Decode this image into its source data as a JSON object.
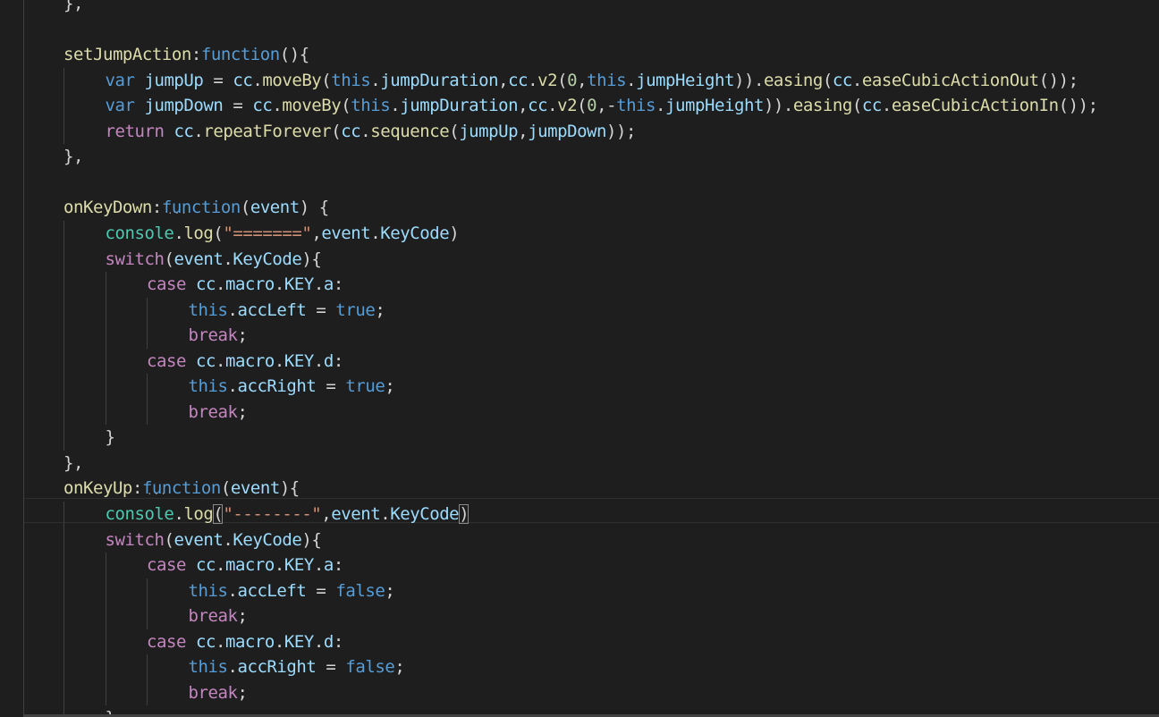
{
  "editor": {
    "language": "javascript",
    "theme": "dark",
    "colors": {
      "background": "#1e1e1e",
      "keyword": "#569cd6",
      "control": "#c586c0",
      "function": "#dcdcaa",
      "variable": "#9cdcfe",
      "object": "#4ec9b0",
      "string": "#ce9178",
      "number": "#b5cea8",
      "text": "#d4d4d4"
    },
    "lines": [
      {
        "indent": 0,
        "tokens": [
          {
            "t": "},",
            "c": "pun"
          }
        ]
      },
      {
        "indent": 0,
        "tokens": []
      },
      {
        "indent": 0,
        "tokens": [
          {
            "t": "setJumpAction",
            "c": "fn"
          },
          {
            "t": ":",
            "c": "pun"
          },
          {
            "t": "function",
            "c": "kw"
          },
          {
            "t": "(){",
            "c": "pun"
          }
        ]
      },
      {
        "indent": 1,
        "tokens": [
          {
            "t": "var",
            "c": "kw"
          },
          {
            "t": " ",
            "c": "pun"
          },
          {
            "t": "jumpUp",
            "c": "var"
          },
          {
            "t": " = ",
            "c": "pun"
          },
          {
            "t": "cc",
            "c": "var"
          },
          {
            "t": ".",
            "c": "pun"
          },
          {
            "t": "moveBy",
            "c": "fn"
          },
          {
            "t": "(",
            "c": "pun"
          },
          {
            "t": "this",
            "c": "kw"
          },
          {
            "t": ".",
            "c": "pun"
          },
          {
            "t": "jumpDuration",
            "c": "var"
          },
          {
            "t": ",",
            "c": "pun"
          },
          {
            "t": "cc",
            "c": "var"
          },
          {
            "t": ".",
            "c": "pun"
          },
          {
            "t": "v2",
            "c": "fn"
          },
          {
            "t": "(",
            "c": "pun"
          },
          {
            "t": "0",
            "c": "num"
          },
          {
            "t": ",",
            "c": "pun"
          },
          {
            "t": "this",
            "c": "kw"
          },
          {
            "t": ".",
            "c": "pun"
          },
          {
            "t": "jumpHeight",
            "c": "var"
          },
          {
            "t": ")).",
            "c": "pun"
          },
          {
            "t": "easing",
            "c": "fn"
          },
          {
            "t": "(",
            "c": "pun"
          },
          {
            "t": "cc",
            "c": "var"
          },
          {
            "t": ".",
            "c": "pun"
          },
          {
            "t": "easeCubicActionOut",
            "c": "fn"
          },
          {
            "t": "());",
            "c": "pun"
          }
        ]
      },
      {
        "indent": 1,
        "tokens": [
          {
            "t": "var",
            "c": "kw"
          },
          {
            "t": " ",
            "c": "pun"
          },
          {
            "t": "jumpDown",
            "c": "var"
          },
          {
            "t": " = ",
            "c": "pun"
          },
          {
            "t": "cc",
            "c": "var"
          },
          {
            "t": ".",
            "c": "pun"
          },
          {
            "t": "moveBy",
            "c": "fn"
          },
          {
            "t": "(",
            "c": "pun"
          },
          {
            "t": "this",
            "c": "kw"
          },
          {
            "t": ".",
            "c": "pun"
          },
          {
            "t": "jumpDuration",
            "c": "var"
          },
          {
            "t": ",",
            "c": "pun"
          },
          {
            "t": "cc",
            "c": "var"
          },
          {
            "t": ".",
            "c": "pun"
          },
          {
            "t": "v2",
            "c": "fn"
          },
          {
            "t": "(",
            "c": "pun"
          },
          {
            "t": "0",
            "c": "num"
          },
          {
            "t": ",-",
            "c": "pun"
          },
          {
            "t": "this",
            "c": "kw"
          },
          {
            "t": ".",
            "c": "pun"
          },
          {
            "t": "jumpHeight",
            "c": "var"
          },
          {
            "t": ")).",
            "c": "pun"
          },
          {
            "t": "easing",
            "c": "fn"
          },
          {
            "t": "(",
            "c": "pun"
          },
          {
            "t": "cc",
            "c": "var"
          },
          {
            "t": ".",
            "c": "pun"
          },
          {
            "t": "easeCubicActionIn",
            "c": "fn"
          },
          {
            "t": "());",
            "c": "pun"
          }
        ]
      },
      {
        "indent": 1,
        "tokens": [
          {
            "t": "return",
            "c": "ctl"
          },
          {
            "t": " ",
            "c": "pun"
          },
          {
            "t": "cc",
            "c": "var"
          },
          {
            "t": ".",
            "c": "pun"
          },
          {
            "t": "repeatForever",
            "c": "fn"
          },
          {
            "t": "(",
            "c": "pun"
          },
          {
            "t": "cc",
            "c": "var"
          },
          {
            "t": ".",
            "c": "pun"
          },
          {
            "t": "sequence",
            "c": "fn"
          },
          {
            "t": "(",
            "c": "pun"
          },
          {
            "t": "jumpUp",
            "c": "var"
          },
          {
            "t": ",",
            "c": "pun"
          },
          {
            "t": "jumpDown",
            "c": "var"
          },
          {
            "t": "));",
            "c": "pun"
          }
        ]
      },
      {
        "indent": 0,
        "tokens": [
          {
            "t": "},",
            "c": "pun"
          }
        ]
      },
      {
        "indent": 0,
        "tokens": []
      },
      {
        "indent": 0,
        "tokens": [
          {
            "t": "onKeyDown",
            "c": "fn"
          },
          {
            "t": ":",
            "c": "pun"
          },
          {
            "t": "function",
            "c": "kw"
          },
          {
            "t": "(",
            "c": "pun"
          },
          {
            "t": "event",
            "c": "var"
          },
          {
            "t": ") {",
            "c": "pun"
          }
        ]
      },
      {
        "indent": 1,
        "tokens": [
          {
            "t": "console",
            "c": "obj"
          },
          {
            "t": ".",
            "c": "pun"
          },
          {
            "t": "log",
            "c": "fn"
          },
          {
            "t": "(",
            "c": "pun"
          },
          {
            "t": "\"=======\"",
            "c": "str"
          },
          {
            "t": ",",
            "c": "pun"
          },
          {
            "t": "event",
            "c": "var"
          },
          {
            "t": ".",
            "c": "pun"
          },
          {
            "t": "KeyCode",
            "c": "var"
          },
          {
            "t": ")",
            "c": "pun"
          }
        ]
      },
      {
        "indent": 1,
        "tokens": [
          {
            "t": "switch",
            "c": "ctl"
          },
          {
            "t": "(",
            "c": "pun"
          },
          {
            "t": "event",
            "c": "var"
          },
          {
            "t": ".",
            "c": "pun"
          },
          {
            "t": "KeyCode",
            "c": "var"
          },
          {
            "t": "){",
            "c": "pun"
          }
        ]
      },
      {
        "indent": 2,
        "tokens": [
          {
            "t": "case",
            "c": "ctl"
          },
          {
            "t": " ",
            "c": "pun"
          },
          {
            "t": "cc",
            "c": "var"
          },
          {
            "t": ".",
            "c": "pun"
          },
          {
            "t": "macro",
            "c": "var"
          },
          {
            "t": ".",
            "c": "pun"
          },
          {
            "t": "KEY",
            "c": "var"
          },
          {
            "t": ".",
            "c": "pun"
          },
          {
            "t": "a",
            "c": "var"
          },
          {
            "t": ":",
            "c": "pun"
          }
        ]
      },
      {
        "indent": 3,
        "tokens": [
          {
            "t": "this",
            "c": "kw"
          },
          {
            "t": ".",
            "c": "pun"
          },
          {
            "t": "accLeft",
            "c": "var"
          },
          {
            "t": " = ",
            "c": "pun"
          },
          {
            "t": "true",
            "c": "kw"
          },
          {
            "t": ";",
            "c": "pun"
          }
        ]
      },
      {
        "indent": 3,
        "tokens": [
          {
            "t": "break",
            "c": "ctl"
          },
          {
            "t": ";",
            "c": "pun"
          }
        ]
      },
      {
        "indent": 2,
        "tokens": [
          {
            "t": "case",
            "c": "ctl"
          },
          {
            "t": " ",
            "c": "pun"
          },
          {
            "t": "cc",
            "c": "var"
          },
          {
            "t": ".",
            "c": "pun"
          },
          {
            "t": "macro",
            "c": "var"
          },
          {
            "t": ".",
            "c": "pun"
          },
          {
            "t": "KEY",
            "c": "var"
          },
          {
            "t": ".",
            "c": "pun"
          },
          {
            "t": "d",
            "c": "var"
          },
          {
            "t": ":",
            "c": "pun"
          }
        ]
      },
      {
        "indent": 3,
        "tokens": [
          {
            "t": "this",
            "c": "kw"
          },
          {
            "t": ".",
            "c": "pun"
          },
          {
            "t": "accRight",
            "c": "var"
          },
          {
            "t": " = ",
            "c": "pun"
          },
          {
            "t": "true",
            "c": "kw"
          },
          {
            "t": ";",
            "c": "pun"
          }
        ]
      },
      {
        "indent": 3,
        "tokens": [
          {
            "t": "break",
            "c": "ctl"
          },
          {
            "t": ";",
            "c": "pun"
          }
        ]
      },
      {
        "indent": 1,
        "tokens": [
          {
            "t": "}",
            "c": "pun"
          }
        ]
      },
      {
        "indent": 0,
        "tokens": [
          {
            "t": "},",
            "c": "pun"
          }
        ]
      },
      {
        "indent": 0,
        "tokens": [
          {
            "t": "onKeyUp",
            "c": "fn"
          },
          {
            "t": ":",
            "c": "pun"
          },
          {
            "t": "function",
            "c": "kw"
          },
          {
            "t": "(",
            "c": "pun"
          },
          {
            "t": "event",
            "c": "var"
          },
          {
            "t": "){",
            "c": "pun"
          }
        ]
      },
      {
        "indent": 1,
        "tokens": [
          {
            "t": "console",
            "c": "obj"
          },
          {
            "t": ".",
            "c": "pun"
          },
          {
            "t": "log",
            "c": "fn"
          },
          {
            "t": "(",
            "c": "pun",
            "box": true
          },
          {
            "t": "\"--------\"",
            "c": "str"
          },
          {
            "t": ",",
            "c": "pun"
          },
          {
            "t": "event",
            "c": "var"
          },
          {
            "t": ".",
            "c": "pun"
          },
          {
            "t": "KeyCode",
            "c": "var"
          },
          {
            "t": ")",
            "c": "pun",
            "box": true
          }
        ]
      },
      {
        "indent": 1,
        "tokens": [
          {
            "t": "switch",
            "c": "ctl"
          },
          {
            "t": "(",
            "c": "pun"
          },
          {
            "t": "event",
            "c": "var"
          },
          {
            "t": ".",
            "c": "pun"
          },
          {
            "t": "KeyCode",
            "c": "var"
          },
          {
            "t": "){",
            "c": "pun"
          }
        ]
      },
      {
        "indent": 2,
        "tokens": [
          {
            "t": "case",
            "c": "ctl"
          },
          {
            "t": " ",
            "c": "pun"
          },
          {
            "t": "cc",
            "c": "var"
          },
          {
            "t": ".",
            "c": "pun"
          },
          {
            "t": "macro",
            "c": "var"
          },
          {
            "t": ".",
            "c": "pun"
          },
          {
            "t": "KEY",
            "c": "var"
          },
          {
            "t": ".",
            "c": "pun"
          },
          {
            "t": "a",
            "c": "var"
          },
          {
            "t": ":",
            "c": "pun"
          }
        ]
      },
      {
        "indent": 3,
        "tokens": [
          {
            "t": "this",
            "c": "kw"
          },
          {
            "t": ".",
            "c": "pun"
          },
          {
            "t": "accLeft",
            "c": "var"
          },
          {
            "t": " = ",
            "c": "pun"
          },
          {
            "t": "false",
            "c": "kw"
          },
          {
            "t": ";",
            "c": "pun"
          }
        ]
      },
      {
        "indent": 3,
        "tokens": [
          {
            "t": "break",
            "c": "ctl"
          },
          {
            "t": ";",
            "c": "pun"
          }
        ]
      },
      {
        "indent": 2,
        "tokens": [
          {
            "t": "case",
            "c": "ctl"
          },
          {
            "t": " ",
            "c": "pun"
          },
          {
            "t": "cc",
            "c": "var"
          },
          {
            "t": ".",
            "c": "pun"
          },
          {
            "t": "macro",
            "c": "var"
          },
          {
            "t": ".",
            "c": "pun"
          },
          {
            "t": "KEY",
            "c": "var"
          },
          {
            "t": ".",
            "c": "pun"
          },
          {
            "t": "d",
            "c": "var"
          },
          {
            "t": ":",
            "c": "pun"
          }
        ]
      },
      {
        "indent": 3,
        "tokens": [
          {
            "t": "this",
            "c": "kw"
          },
          {
            "t": ".",
            "c": "pun"
          },
          {
            "t": "accRight",
            "c": "var"
          },
          {
            "t": " = ",
            "c": "pun"
          },
          {
            "t": "false",
            "c": "kw"
          },
          {
            "t": ";",
            "c": "pun"
          }
        ]
      },
      {
        "indent": 3,
        "tokens": [
          {
            "t": "break",
            "c": "ctl"
          },
          {
            "t": ";",
            "c": "pun"
          }
        ]
      },
      {
        "indent": 1,
        "tokens": [
          {
            "t": "}",
            "c": "pun"
          }
        ]
      }
    ]
  }
}
